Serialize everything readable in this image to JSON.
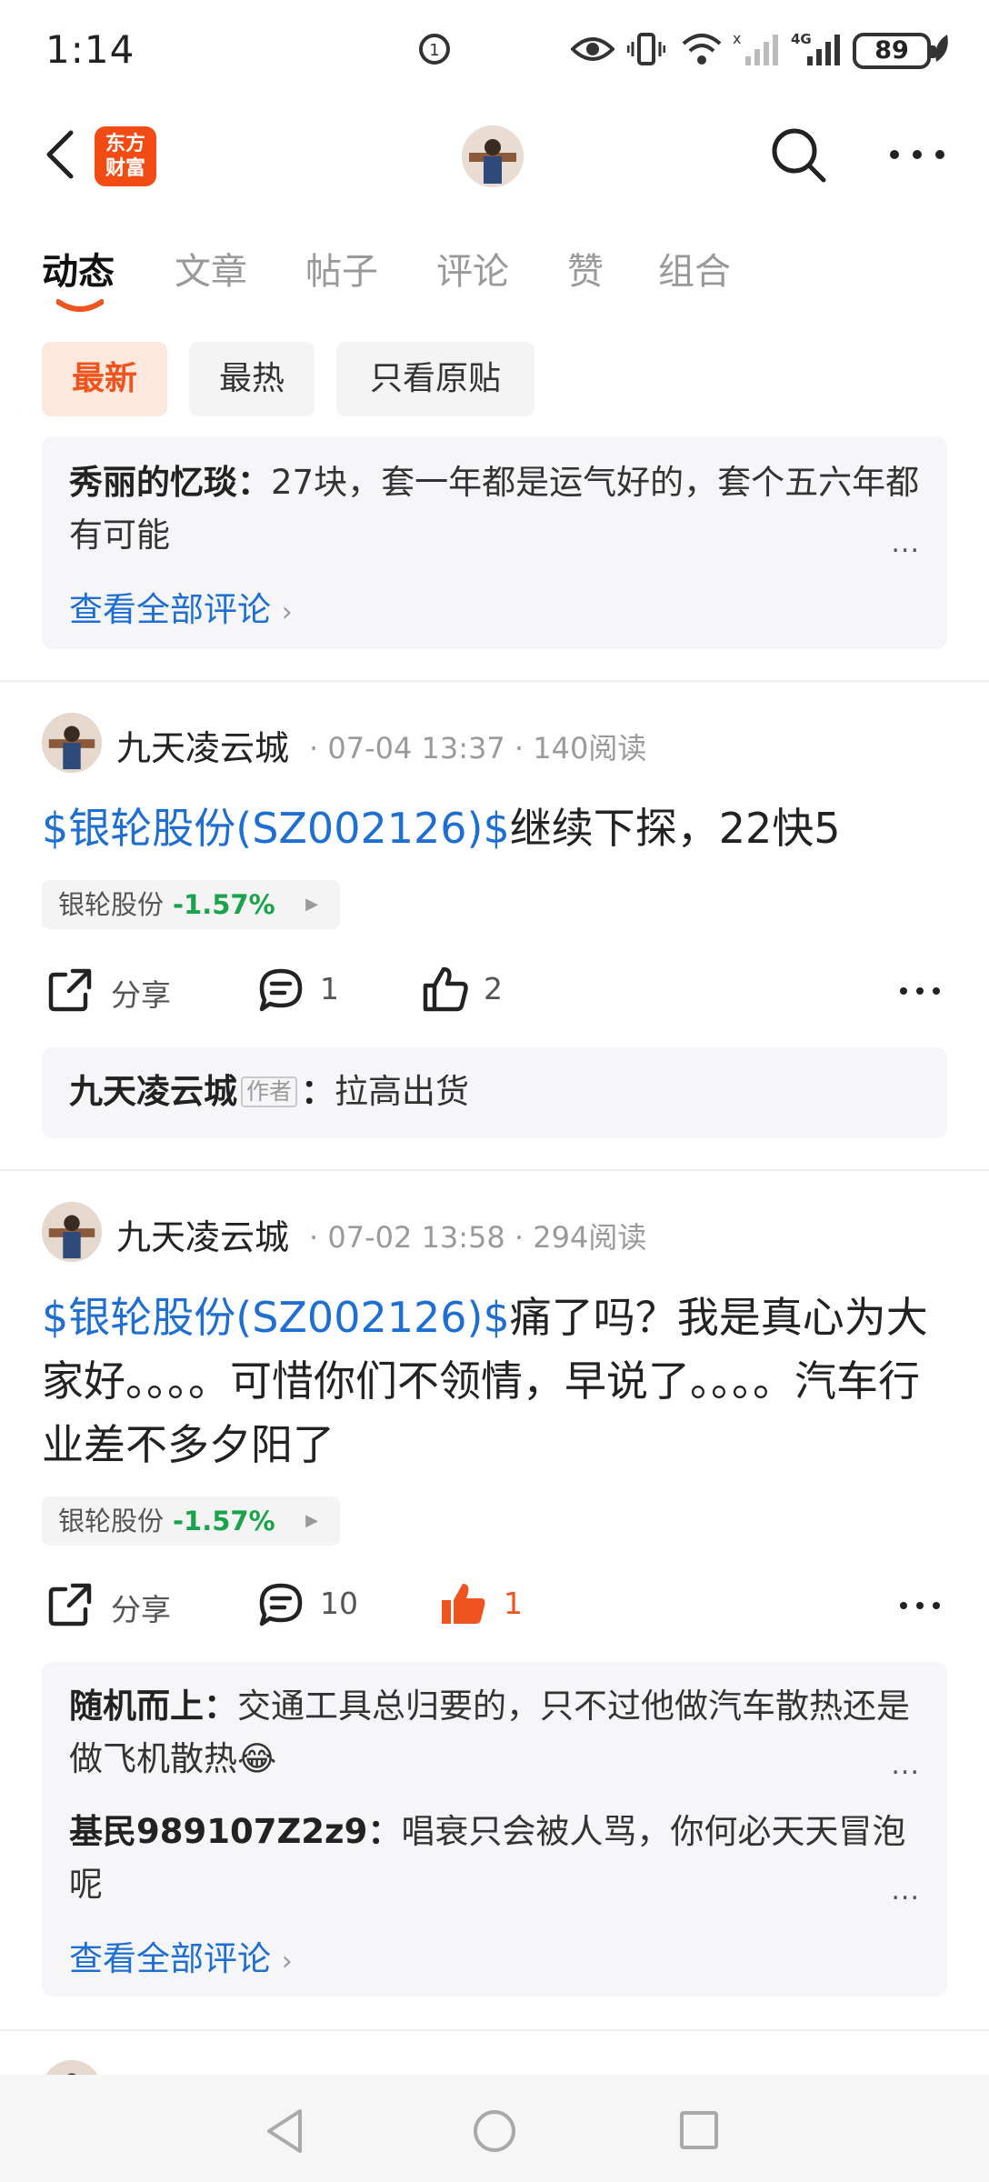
{
  "status_bar": {
    "time": "1:14",
    "battery": "89"
  },
  "header": {
    "logo_text": "东方\n财富"
  },
  "tabs": [
    {
      "label": "动态",
      "active": true
    },
    {
      "label": "文章"
    },
    {
      "label": "帖子"
    },
    {
      "label": "评论"
    },
    {
      "label": "赞"
    },
    {
      "label": "组合"
    }
  ],
  "filters": [
    {
      "label": "最新",
      "active": true
    },
    {
      "label": "最热"
    },
    {
      "label": "只看原贴"
    }
  ],
  "top_comments": {
    "comment": {
      "user": "秀丽的忆琰",
      "sep": "：",
      "text": "27块，套一年都是运气好的，套个五六年都有可能"
    },
    "see_all": "查看全部评论",
    "ellipsis": "..."
  },
  "posts": [
    {
      "user": "九天凌云城",
      "date": "07-04 13:37",
      "reads": "140阅读",
      "stock_link": "$银轮股份(SZ002126)$",
      "text": "继续下探，22快5",
      "stock_chip": {
        "name": "银轮股份",
        "change": "-1.57%"
      },
      "share_label": "分享",
      "comments": "1",
      "likes": "2",
      "liked": false,
      "reply": {
        "user": "九天凌云城",
        "tag": "作者",
        "sep": "：",
        "text": "拉高出货"
      }
    },
    {
      "user": "九天凌云城",
      "date": "07-02 13:58",
      "reads": "294阅读",
      "stock_link": "$银轮股份(SZ002126)$",
      "text": "痛了吗？我是真心为大家好。。。。可惜你们不领情，早说了。。。。汽车行业差不多夕阳了",
      "stock_chip": {
        "name": "银轮股份",
        "change": "-1.57%"
      },
      "share_label": "分享",
      "comments": "10",
      "likes": "1",
      "liked": true,
      "replies": [
        {
          "user": "随机而上",
          "sep": "：",
          "text": "交通工具总归要的，只不过他做汽车散热还是做飞机散热😂"
        },
        {
          "user": "基民989107Z2z9",
          "sep": "：",
          "text": "唱衰只会被人骂，你何必天天冒泡呢"
        }
      ],
      "see_all": "查看全部评论",
      "ellipsis": "..."
    }
  ],
  "colors": {
    "accent": "#f0541e",
    "link": "#1e6fd1",
    "down": "#1aa34a",
    "like_active": "#f0541e"
  }
}
